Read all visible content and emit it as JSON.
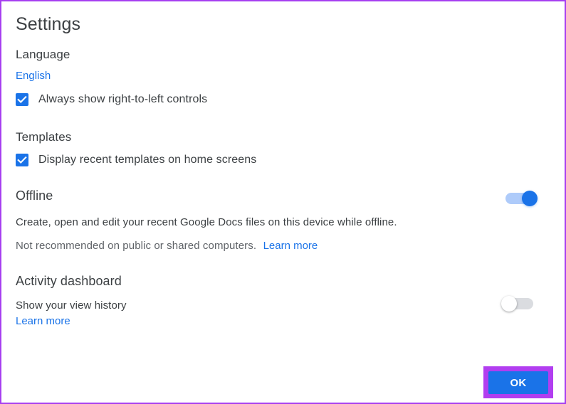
{
  "dialog": {
    "title": "Settings",
    "border_color": "#a63ff0"
  },
  "sections": {
    "language": {
      "heading": "Language",
      "current_language_link": "English",
      "rtl_checkbox": {
        "label": "Always show right-to-left controls",
        "checked": true
      }
    },
    "templates": {
      "heading": "Templates",
      "recent_templates_checkbox": {
        "label": "Display recent templates on home screens",
        "checked": true
      }
    },
    "offline": {
      "heading": "Offline",
      "description": "Create, open and edit your recent Google Docs files on this device while offline.",
      "warning": "Not recommended on public or shared computers.",
      "learn_more_link": "Learn more",
      "toggle": {
        "state": "on",
        "on_track_color": "#aecbfa",
        "on_knob_color": "#1a73e8"
      }
    },
    "activity_dashboard": {
      "heading": "Activity dashboard",
      "description": "Show your view history",
      "learn_more_link": "Learn more",
      "toggle": {
        "state": "off",
        "off_track_color": "#dadce0",
        "off_knob_color": "#ffffff"
      }
    }
  },
  "footer": {
    "ok_label": "OK",
    "ok_background": "#1a73e8",
    "focus_highlight_color": "#b23ef0"
  },
  "colors": {
    "link": "#1a73e8",
    "text_primary": "#3c4043",
    "text_muted": "#5f6368"
  }
}
